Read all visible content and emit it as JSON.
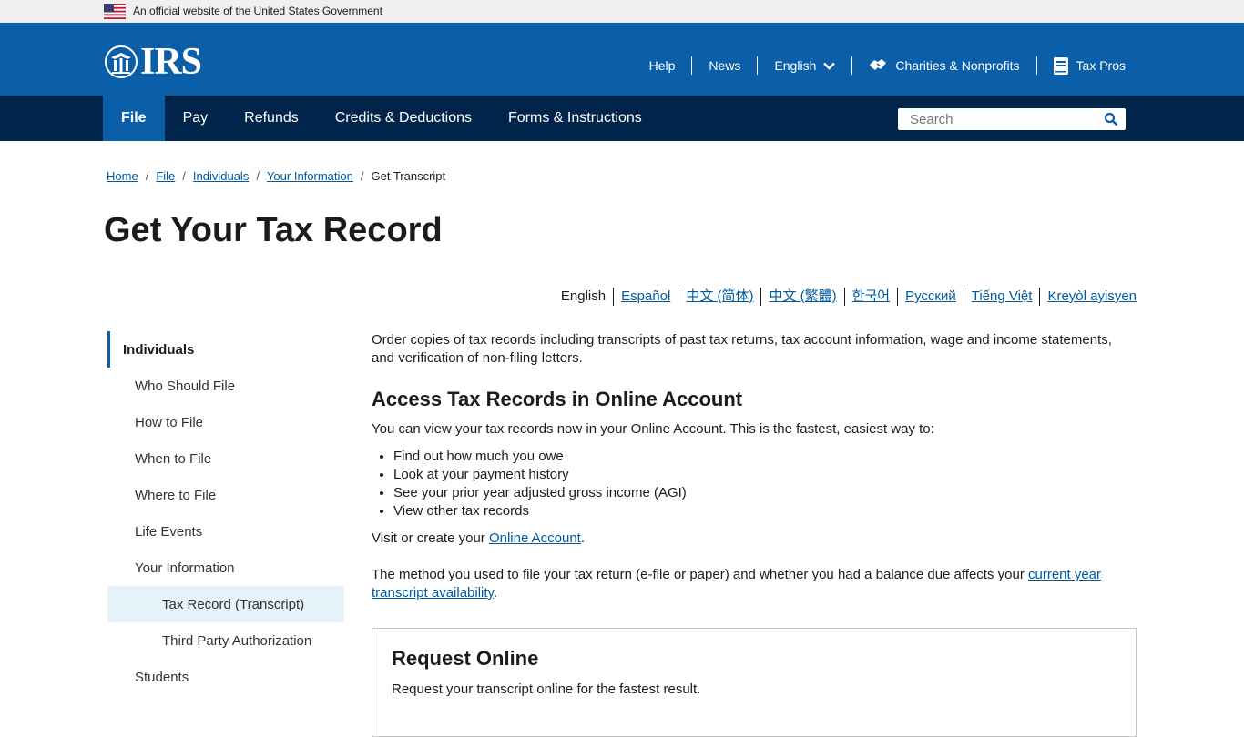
{
  "gov_banner": {
    "text": "An official website of the United States Government"
  },
  "header": {
    "logo_text": "IRS",
    "utility_nav": [
      {
        "label": "Help",
        "icon": ""
      },
      {
        "label": "News",
        "icon": ""
      },
      {
        "label": "English",
        "icon": "chevron-down-icon"
      },
      {
        "label": "Charities & Nonprofits",
        "icon": "handshake-icon"
      },
      {
        "label": "Tax Pros",
        "icon": "book-icon"
      }
    ]
  },
  "main_nav": {
    "items": [
      "File",
      "Pay",
      "Refunds",
      "Credits & Deductions",
      "Forms & Instructions"
    ],
    "active": "File"
  },
  "search": {
    "placeholder": "Search"
  },
  "breadcrumb": {
    "links": [
      "Home",
      "File",
      "Individuals",
      "Your Information"
    ],
    "current": "Get Transcript"
  },
  "page": {
    "title": "Get Your Tax Record"
  },
  "languages": [
    "English",
    "Español",
    "中文 (简体)",
    "中文 (繁體)",
    "한국어",
    "Русский",
    "Tiếng Việt",
    "Kreyòl ayisyen"
  ],
  "sidebar": {
    "heading": "Individuals",
    "items": [
      "Who Should File",
      "How to File",
      "When to File",
      "Where to File",
      "Life Events",
      "Your Information"
    ],
    "subitems": [
      "Tax Record (Transcript)",
      "Third Party Authorization"
    ],
    "after": "Students"
  },
  "content": {
    "intro": "Order copies of tax records including transcripts of past tax returns, tax account information, wage and income statements, and verification of non-filing letters.",
    "section_title": "Access Tax Records in Online Account",
    "section_lead": "You can view your tax records now in your Online Account. This is the fastest, easiest way to:",
    "bullets": [
      "Find out how much you owe",
      "Look at your payment history",
      "See your prior year adjusted gross income (AGI)",
      "View other tax records"
    ],
    "visit_prefix": "Visit or create your ",
    "visit_link": "Online Account",
    "visit_suffix": ".",
    "method_prefix": "The method you used to file your tax return (e-file or paper) and whether you had a balance due affects  your ",
    "method_link": "current year transcript availability",
    "method_suffix": "."
  },
  "card": {
    "title": "Request Online",
    "text": "Request your transcript online for the fastest result."
  }
}
